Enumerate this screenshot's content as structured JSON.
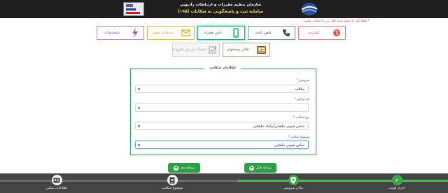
{
  "header": {
    "org_title": "سازمان تنظیم مقررات و ارتباطات رادیویی",
    "system_title": "سامانه ثبت و پاسخگویی به شکایات (۱۹۵)",
    "logo_left_icon": "cra-flag-logo",
    "logo_right_icon": "globe-wave-logo"
  },
  "instruction": "* لطفا یکی از دسته بندی های زیر را انتخاب نمایید :",
  "categories": {
    "internet": {
      "label": "اینترنت",
      "icon": "globe-icon",
      "color": "#c0392b"
    },
    "landline": {
      "label": "تلفن ثابت",
      "icon": "phone-icon",
      "color": "#2c3e50"
    },
    "mobile": {
      "label": "تلفن همراه",
      "icon": "mobile-icon",
      "color": "#1e7a6a",
      "selected": true
    },
    "postal": {
      "label": "خدمات پستی",
      "icon": "mail-icon",
      "color": "#d19b12"
    },
    "broadcast": {
      "label": "تشعشعات",
      "icon": "lightning-icon",
      "color": "#8e44ad"
    },
    "offices": {
      "label": "دفاتر پیشخوان",
      "icon": "id-card-icon",
      "color": "#6b5532"
    },
    "vas": {
      "label": "خدمات ارزش افزوده",
      "icon": "checkbox-icon",
      "color": "#9a9a9a"
    }
  },
  "form": {
    "legend": "اطلاعات شکایت",
    "service": {
      "label": "سرویس *",
      "value": "مکالمه"
    },
    "operator": {
      "label": "نام اپراتور *",
      "value": ""
    },
    "complaint_type": {
      "label": "نوع شکایت *",
      "value": "تماس صوتی تبلیغاتی/پیامک تبلیغاتی"
    },
    "complaint_subject": {
      "label": "موضوع شکایت *",
      "value": "تماس صوتی تبلیغاتی"
    }
  },
  "buttons": {
    "next": "مرحله بعد",
    "prev": "مرحله قبل"
  },
  "steps": [
    {
      "label": "احراز هویت",
      "icon": "check-icon",
      "state": "done"
    },
    {
      "label": "مکان سرویس",
      "icon": "map-pin-icon",
      "state": "current"
    },
    {
      "label": "موضوع شکایت",
      "icon": "document-icon",
      "state": "todo"
    },
    {
      "label": "اطلاعات تماس",
      "icon": "contact-card-icon",
      "state": "todo"
    }
  ]
}
